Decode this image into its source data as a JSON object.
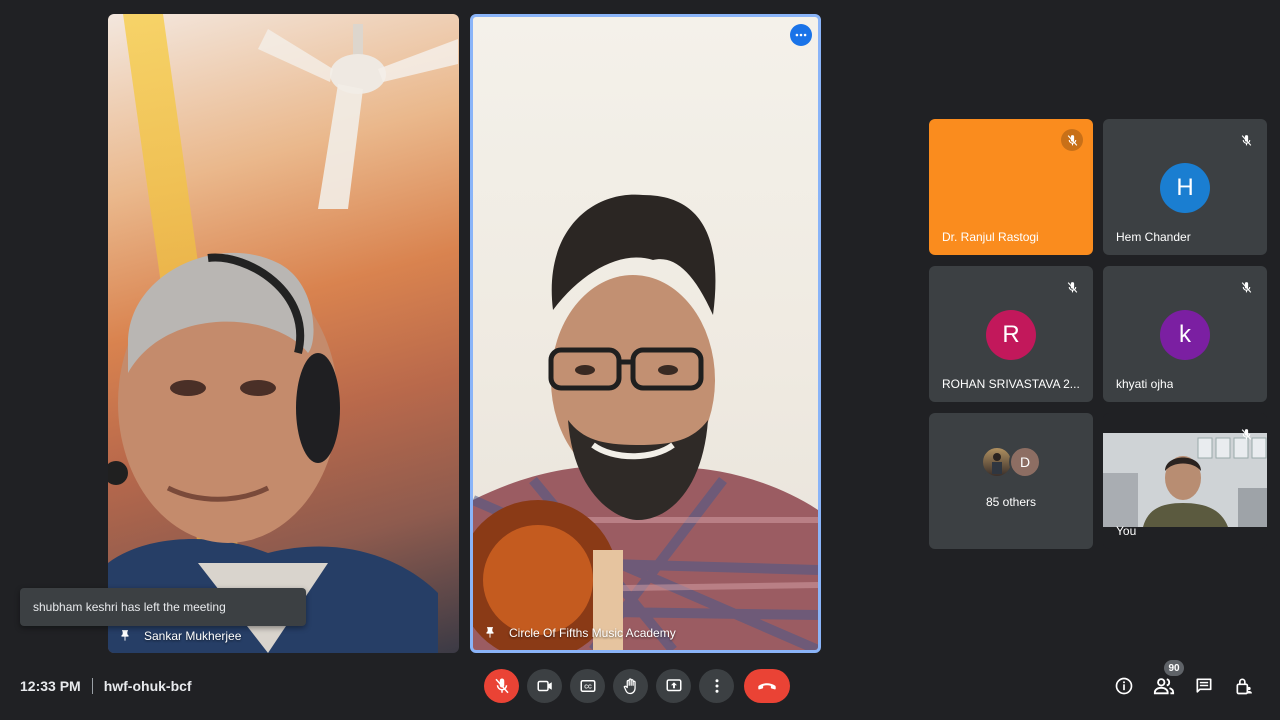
{
  "main_tiles": [
    {
      "name": "Sankar Mukherjee"
    },
    {
      "name": "Circle Of Fifths Music Academy"
    }
  ],
  "toast": {
    "text": "shubham keshri has left the meeting"
  },
  "participants": [
    {
      "name": "Dr. Ranjul Rastogi",
      "tile_color": "#fa8c1e"
    },
    {
      "name": "Hem Chander",
      "initial": "H",
      "avatar_color": "#1a7ed1"
    },
    {
      "name": "ROHAN SRIVASTAVA 2...",
      "initial": "R",
      "avatar_color": "#c2185b"
    },
    {
      "name": "khyati ojha",
      "initial": "k",
      "avatar_color": "#7b1fa2"
    },
    {
      "others_label": "85 others",
      "mini_initial": "D"
    },
    {
      "name": "You"
    }
  ],
  "bottom_bar": {
    "time": "12:33 PM",
    "meeting_code": "hwf-ohuk-bcf",
    "people_count": "90"
  },
  "icons": {
    "mic": "mic-off-icon",
    "camera": "videocam-icon",
    "captions": "closed-caption-icon",
    "hand": "raise-hand-icon",
    "present": "present-screen-icon",
    "more": "more-vert-icon",
    "end": "call-end-icon",
    "info": "info-icon",
    "people": "people-icon",
    "chat": "chat-icon",
    "activities": "lock-person-icon"
  }
}
